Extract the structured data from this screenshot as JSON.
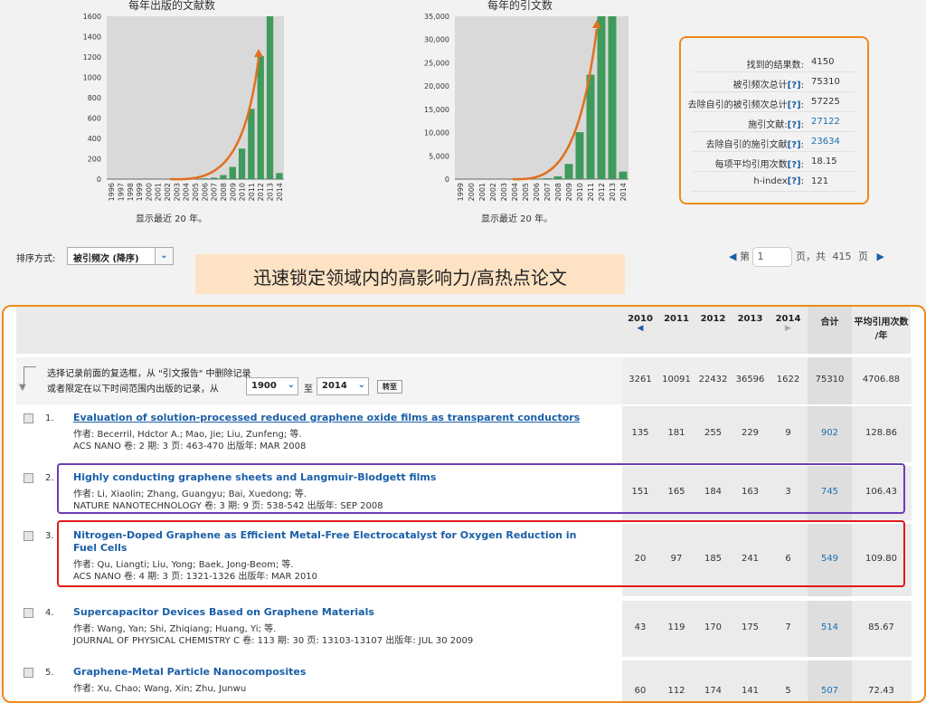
{
  "charts": {
    "pubs": {
      "title": "每年出版的文献数",
      "note": "显示最近 20 年。",
      "y_ticks": [
        "0",
        "200",
        "400",
        "600",
        "800",
        "1000",
        "1200",
        "1400",
        "1600"
      ],
      "x_labels": [
        "1996",
        "1997",
        "1998",
        "1999",
        "2000",
        "2001",
        "2002",
        "2003",
        "2004",
        "2005",
        "2006",
        "2007",
        "2008",
        "2009",
        "2010",
        "2011",
        "2012",
        "2013",
        "2014"
      ]
    },
    "cites": {
      "title": "每年的引文数",
      "note": "显示最近 20 年。",
      "y_ticks": [
        "0",
        "5,000",
        "10,000",
        "15,000",
        "20,000",
        "25,000",
        "30,000",
        "35,000"
      ],
      "x_labels": [
        "1999",
        "2000",
        "2001",
        "2002",
        "2003",
        "2004",
        "2005",
        "2006",
        "2007",
        "2008",
        "2009",
        "2010",
        "2011",
        "2012",
        "2013",
        "2014"
      ]
    },
    "bar_color": "#3f9a5c",
    "arrow_color": "#e07020"
  },
  "chart_data": [
    {
      "type": "bar",
      "title": "每年出版的文献数",
      "categories": [
        "1996",
        "1997",
        "1998",
        "1999",
        "2000",
        "2001",
        "2002",
        "2003",
        "2004",
        "2005",
        "2006",
        "2007",
        "2008",
        "2009",
        "2010",
        "2011",
        "2012",
        "2013",
        "2014"
      ],
      "values": [
        0,
        0,
        0,
        0,
        0,
        0,
        0,
        0,
        2,
        3,
        8,
        15,
        40,
        120,
        300,
        690,
        1210,
        1630,
        60
      ],
      "ylim": [
        0,
        1600
      ]
    },
    {
      "type": "bar",
      "title": "每年的引文数",
      "categories": [
        "1999",
        "2000",
        "2001",
        "2002",
        "2003",
        "2004",
        "2005",
        "2006",
        "2007",
        "2008",
        "2009",
        "2010",
        "2011",
        "2012",
        "2013",
        "2014"
      ],
      "values": [
        0,
        0,
        0,
        0,
        0,
        0,
        30,
        80,
        200,
        600,
        3261,
        10091,
        22432,
        36596,
        36596,
        1622
      ],
      "ylim": [
        0,
        35000
      ]
    }
  ],
  "stats": [
    {
      "label": "找到的结果数:",
      "q": "",
      "value": "4150",
      "link": false
    },
    {
      "label": "被引频次总计",
      "q": "[?]",
      "value": "75310",
      "link": false
    },
    {
      "label": "去除自引的被引频次总计",
      "q": "[?]",
      "value": "57225",
      "link": false
    },
    {
      "label": "施引文献:",
      "q": "[?]",
      "value": "27122",
      "link": true
    },
    {
      "label": "去除自引的施引文献",
      "q": "[?]",
      "value": "23634",
      "link": true
    },
    {
      "label": "每项平均引用次数",
      "q": "[?]",
      "value": "18.15",
      "link": false
    },
    {
      "label": "h-index",
      "q": "[?]",
      "value": "121",
      "link": false
    }
  ],
  "sort": {
    "label": "排序方式:",
    "value": "被引频次 (降序)"
  },
  "banner": "迅速锁定领域内的高影响力/高热点论文",
  "pager": {
    "prefix": "第",
    "page": "1",
    "middle": "页，共",
    "total": "415",
    "suffix": "页"
  },
  "columns": [
    "2010",
    "2011",
    "2012",
    "2013",
    "2014",
    "合计",
    "平均引用次数/年"
  ],
  "filter": {
    "line1": "选择记录前面的复选框，从 \"引文报告\" 中删除记录",
    "line2": "或者限定在以下时间范围内出版的记录，从",
    "from": "1900",
    "to_word": "至",
    "to": "2014",
    "go": "转至",
    "totals": [
      "3261",
      "10091",
      "22432",
      "36596",
      "1622",
      "75310",
      "4706.88"
    ]
  },
  "records": [
    {
      "n": "1.",
      "title": "Evaluation of solution-processed reduced graphene oxide films as transparent conductors",
      "authors": "作者: Becerril, Hdctor A.; Mao, Jie; Liu, Zunfeng; 等.",
      "source": "ACS NANO  卷: 2  期: 3  页: 463-470  出版年: MAR 2008",
      "cells": [
        "135",
        "181",
        "255",
        "229",
        "9",
        "902",
        "128.86"
      ]
    },
    {
      "n": "2.",
      "title": "Highly conducting graphene sheets and Langmuir-Blodgett films",
      "authors": "作者: Li, Xiaolin; Zhang, Guangyu; Bai, Xuedong; 等.",
      "source": "NATURE NANOTECHNOLOGY  卷: 3  期: 9  页: 538-542  出版年: SEP 2008",
      "cells": [
        "151",
        "165",
        "184",
        "163",
        "3",
        "745",
        "106.43"
      ]
    },
    {
      "n": "3.",
      "title": "Nitrogen-Doped Graphene as Efficient Metal-Free Electrocatalyst for Oxygen Reduction in",
      "title2": "Fuel Cells",
      "authors": "作者: Qu, Liangti; Liu, Yong; Baek, Jong-Beom; 等.",
      "source": "ACS NANO  卷: 4  期: 3  页: 1321-1326  出版年: MAR 2010",
      "cells": [
        "20",
        "97",
        "185",
        "241",
        "6",
        "549",
        "109.80"
      ]
    },
    {
      "n": "4.",
      "title": "Supercapacitor Devices Based on Graphene Materials",
      "authors": "作者: Wang, Yan; Shi, Zhiqiang; Huang, Yi; 等.",
      "source": "JOURNAL OF PHYSICAL CHEMISTRY C  卷: 113  期: 30  页: 13103-13107  出版年: JUL 30 2009",
      "cells": [
        "43",
        "119",
        "170",
        "175",
        "7",
        "514",
        "85.67"
      ]
    },
    {
      "n": "5.",
      "title": "Graphene-Metal Particle Nanocomposites",
      "authors": "作者: Xu, Chao; Wang, Xin; Zhu, Junwu",
      "source": "",
      "cells": [
        "60",
        "112",
        "174",
        "141",
        "5",
        "507",
        "72.43"
      ]
    }
  ],
  "colors": {
    "orange": "#ee8a1c",
    "purple": "#6a3db5",
    "red": "#e21a1a",
    "link": "#1a5fa8"
  }
}
